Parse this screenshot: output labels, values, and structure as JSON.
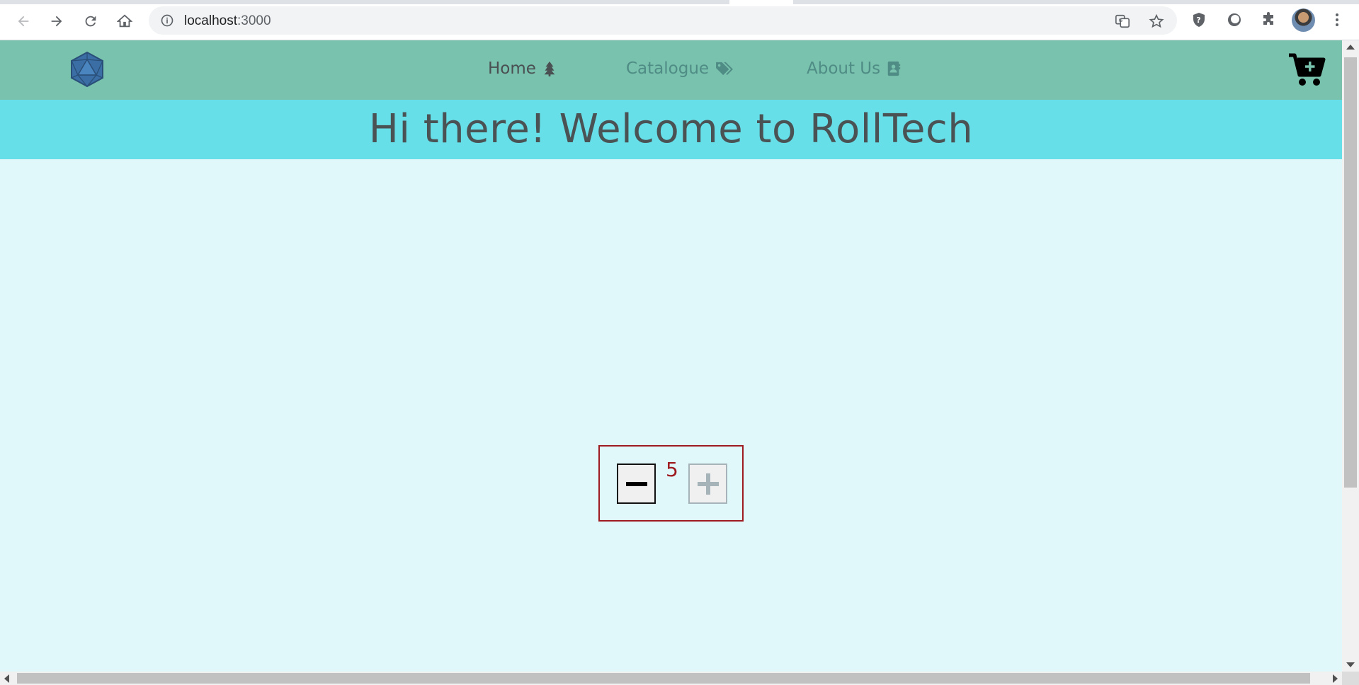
{
  "browser": {
    "url_host": "localhost",
    "url_port": ":3000"
  },
  "site": {
    "nav": {
      "home_label": "Home",
      "catalogue_label": "Catalogue",
      "about_label": "About Us"
    },
    "welcome_text": "Hi there! Welcome to RollTech"
  },
  "counter": {
    "value": "5"
  },
  "colors": {
    "nav_background": "#79c2ad",
    "banner_background": "#67dfe9",
    "page_background": "#e1f8fb",
    "counter_accent": "#9e1b20"
  },
  "icons": {
    "home": "tree-icon",
    "catalogue": "tags-icon",
    "about": "address-book-icon",
    "cart": "cart-plus-icon",
    "logo": "d20-dice-icon"
  }
}
